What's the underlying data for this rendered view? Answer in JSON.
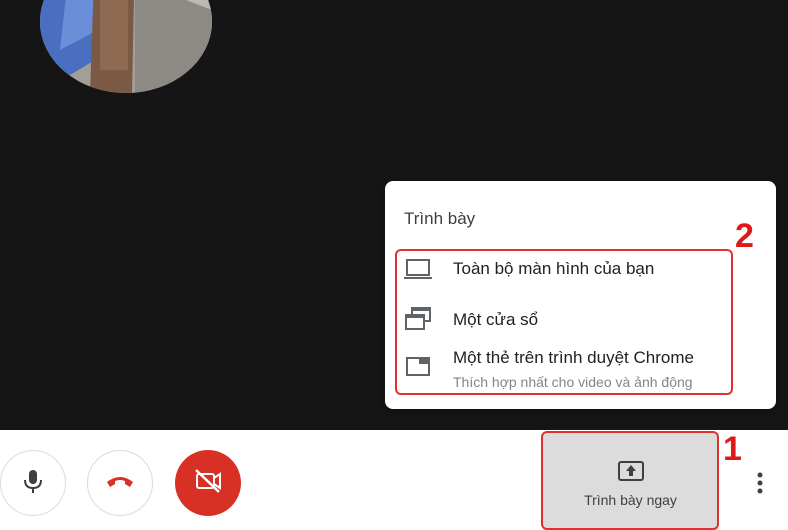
{
  "present_menu": {
    "title": "Trình bày",
    "items": [
      {
        "label": "Toàn bộ màn hình của bạn",
        "icon": "laptop-icon"
      },
      {
        "label": "Một cửa sổ",
        "icon": "window-stack-icon"
      },
      {
        "label": "Một thẻ trên trình duyệt Chrome",
        "sublabel": "Thích hợp nhất cho video và ảnh động",
        "icon": "browser-tab-icon"
      }
    ]
  },
  "annotations": {
    "step1": "1",
    "step2": "2"
  },
  "toolbar": {
    "mic_icon": "microphone-icon",
    "hangup_icon": "phone-hangup-icon",
    "camera_icon": "camera-off-icon",
    "present_label": "Trình bày ngay",
    "present_icon": "present-screen-icon",
    "more_icon": "more-vertical-icon"
  },
  "colors": {
    "stage_bg": "#151515",
    "hangup_red": "#ea4335",
    "camera_btn": "#d93025",
    "annotation_red": "#e01818"
  }
}
